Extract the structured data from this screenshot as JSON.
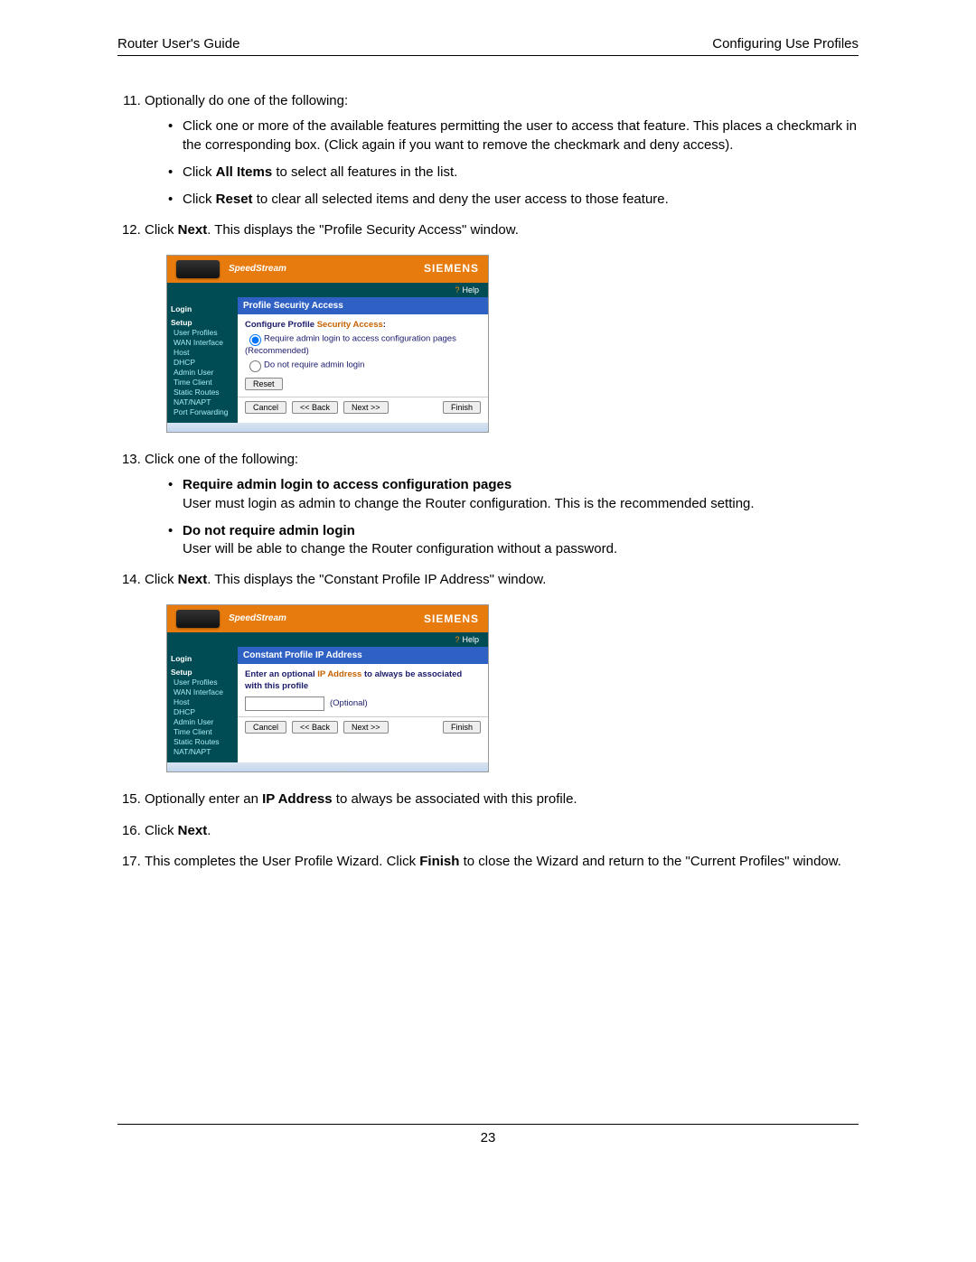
{
  "header": {
    "left": "Router User's Guide",
    "right": "Configuring Use Profiles"
  },
  "footer": {
    "page_number": "23"
  },
  "steps": {
    "s11": "Optionally do one of the following:",
    "s11_bullets": {
      "b1": "Click one or more of the available features permitting the user to access that feature. This places a checkmark in the corresponding box. (Click again if you want to remove the checkmark and deny access).",
      "b2_pre": "Click ",
      "b2_bold": "All Items",
      "b2_post": " to select all features in the list.",
      "b3_pre": "Click ",
      "b3_bold": "Reset",
      "b3_post": " to clear all selected items and deny the user access to those feature."
    },
    "s12_pre": "Click ",
    "s12_bold": "Next",
    "s12_post": ". This displays the \"Profile Security Access\" window.",
    "s13": "Click one of the following:",
    "s13_bullets": {
      "b1_bold": "Require admin login to access configuration pages",
      "b1_body": "User must login as admin to change the Router configuration. This is the recommended setting.",
      "b2_bold": "Do not require admin login",
      "b2_body": "User will be able to change the Router configuration without a password."
    },
    "s14_pre": "Click ",
    "s14_bold": "Next",
    "s14_post": ". This displays the \"Constant Profile IP Address\" window.",
    "s15_pre": "Optionally enter an ",
    "s15_bold": "IP Address",
    "s15_post": " to always be associated with this profile.",
    "s16_pre": "Click ",
    "s16_bold": "Next",
    "s16_post": ".",
    "s17_pre": "This completes the User Profile Wizard. Click ",
    "s17_bold": "Finish",
    "s17_post": " to close the Wizard and return to the \"Current Profiles\" window."
  },
  "screenshot1": {
    "brand": "SpeedStream",
    "vendor": "SIEMENS",
    "help": "Help",
    "nav_login": "Login",
    "nav_setup": "Setup",
    "nav_items": [
      "User Profiles",
      "WAN Interface",
      "Host",
      "DHCP",
      "Admin User",
      "Time Client",
      "Static Routes",
      "NAT/NAPT",
      "Port Forwarding"
    ],
    "panel_title": "Profile Security Access",
    "cfg_label_pre": "Configure Profile ",
    "cfg_label_orange": "Security Access",
    "cfg_label_post": ":",
    "radio1": "Require admin login to access configuration pages",
    "recommended": "(Recommended)",
    "radio2": "Do not require admin login",
    "btn_reset": "Reset",
    "btn_cancel": "Cancel",
    "btn_back": "<< Back",
    "btn_next": "Next >>",
    "btn_finish": "Finish"
  },
  "screenshot2": {
    "brand": "SpeedStream",
    "vendor": "SIEMENS",
    "help": "Help",
    "nav_login": "Login",
    "nav_setup": "Setup",
    "nav_items": [
      "User Profiles",
      "WAN Interface",
      "Host",
      "DHCP",
      "Admin User",
      "Time Client",
      "Static Routes",
      "NAT/NAPT"
    ],
    "panel_title": "Constant Profile IP Address",
    "body_pre": "Enter an optional ",
    "body_orange": "IP Address",
    "body_post": " to always be associated with this profile",
    "optional_label": "(Optional)",
    "btn_cancel": "Cancel",
    "btn_back": "<< Back",
    "btn_next": "Next >>",
    "btn_finish": "Finish"
  }
}
